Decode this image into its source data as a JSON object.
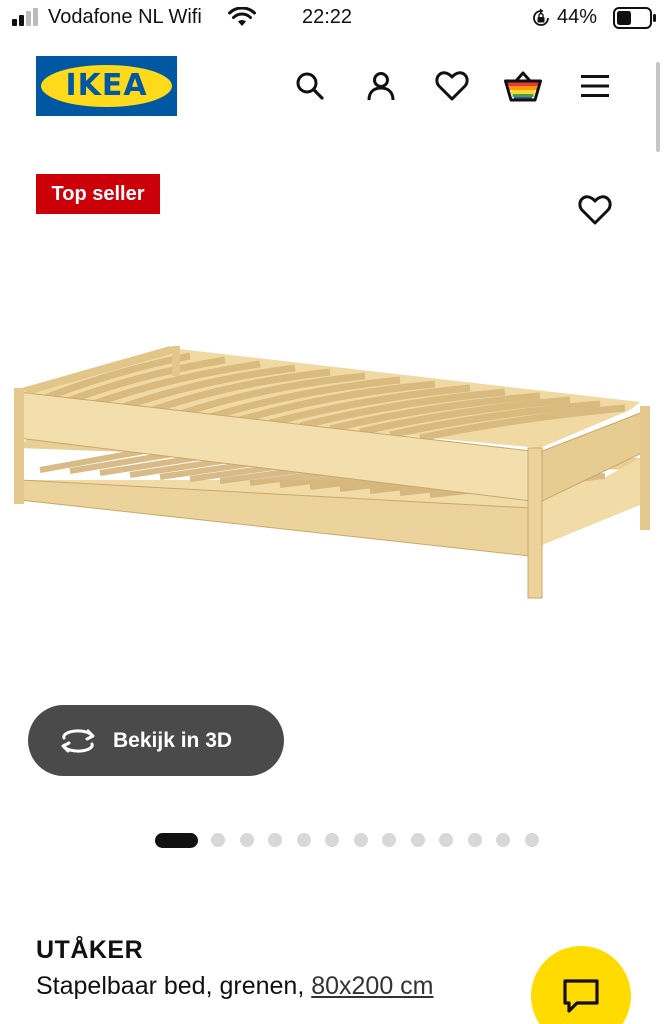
{
  "status_bar": {
    "carrier": "Vodafone NL Wifi",
    "time": "22:22",
    "battery": "44%"
  },
  "header": {
    "logo_text": "IKEA",
    "icons": [
      "search-icon",
      "account-icon",
      "heart-icon",
      "basket-icon",
      "menu-icon"
    ]
  },
  "product": {
    "badge": "Top seller",
    "view_3d_label": "Bekijk in 3D",
    "name": "UTÅKER",
    "description": "Stapelbaar bed, grenen, ",
    "size": "80x200 cm",
    "image_count": 13,
    "active_image": 1
  },
  "colors": {
    "ikea_blue": "#0058a3",
    "ikea_yellow": "#ffda1a",
    "badge_red": "#cc0008",
    "chat_yellow": "#ffdb00",
    "button_dark": "#4a4a4a"
  }
}
